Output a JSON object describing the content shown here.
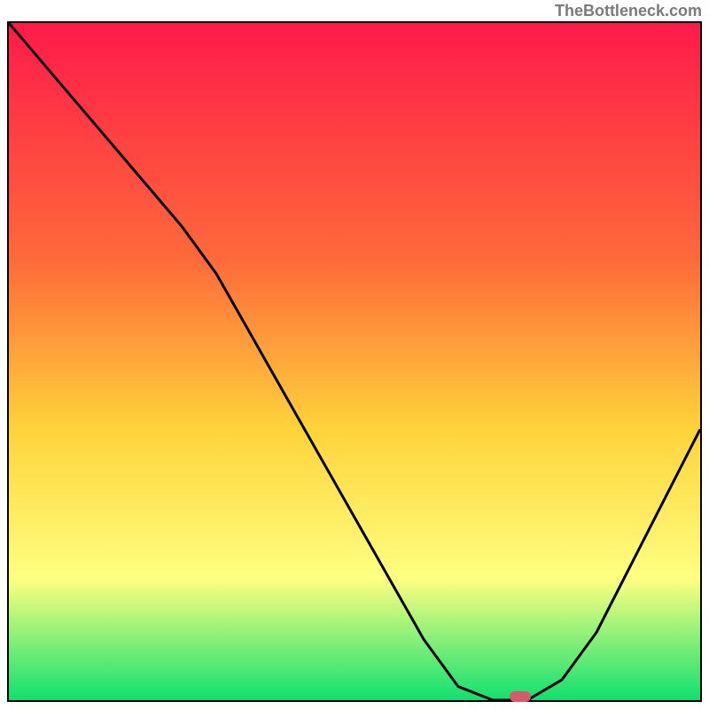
{
  "attribution": "TheBottleneck.com",
  "colors": {
    "grad_top": "#ff1a4a",
    "grad_mid1": "#ff6a3a",
    "grad_mid2": "#ffd33a",
    "grad_mid3": "#ffff80",
    "grad_bottom": "#10e070",
    "marker": "#d85a6a",
    "curve": "#000000"
  },
  "chart_data": {
    "type": "line",
    "title": "",
    "xlabel": "",
    "ylabel": "",
    "xlim": [
      0,
      100
    ],
    "ylim": [
      0,
      100
    ],
    "x": [
      0,
      5,
      10,
      15,
      20,
      25,
      30,
      35,
      40,
      45,
      50,
      55,
      60,
      65,
      70,
      75,
      80,
      85,
      90,
      95,
      100
    ],
    "values": [
      100,
      94,
      88,
      82,
      76,
      70,
      63,
      54,
      45,
      36,
      27,
      18,
      9,
      2,
      0,
      0,
      3,
      10,
      20,
      30,
      40
    ],
    "marker_x": 74,
    "marker_y": 0,
    "note": "Values are estimated from the plotted curve shape; y is height above the bottom edge as a percentage of full height."
  }
}
